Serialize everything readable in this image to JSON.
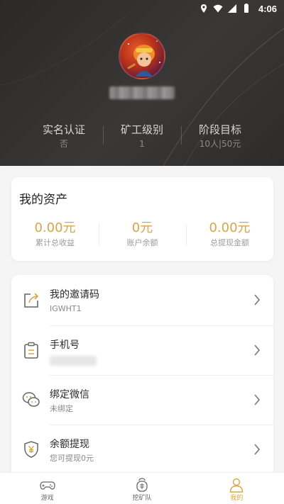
{
  "status_bar": {
    "time": "4:06"
  },
  "profile": {
    "stats": [
      {
        "label": "实名认证",
        "value": "否"
      },
      {
        "label": "矿工级别",
        "value": "1"
      },
      {
        "label": "阶段目标",
        "value": "10人|50元"
      }
    ]
  },
  "assets": {
    "title": "我的资产",
    "items": [
      {
        "amount": "0.00元",
        "caption": "累计总收益"
      },
      {
        "amount": "0元",
        "caption": "账户余额"
      },
      {
        "amount": "0.00元",
        "caption": "总提现金额"
      }
    ]
  },
  "menu": [
    {
      "title": "我的邀请码",
      "sub": "IGWHT1",
      "icon": "share-icon"
    },
    {
      "title": "手机号",
      "sub": "",
      "icon": "clipboard-icon"
    },
    {
      "title": "绑定微信",
      "sub": "未绑定",
      "icon": "wechat-icon"
    },
    {
      "title": "余额提现",
      "sub": "您可提现0元",
      "icon": "yen-shield-icon"
    }
  ],
  "tabs": [
    {
      "label": "游戏",
      "icon": "gamepad-icon",
      "active": false
    },
    {
      "label": "挖矿队",
      "icon": "mining-icon",
      "active": false
    },
    {
      "label": "我的",
      "icon": "person-icon",
      "active": true
    }
  ],
  "colors": {
    "accent": "#d7a548",
    "header_bg": "#2b2928"
  }
}
